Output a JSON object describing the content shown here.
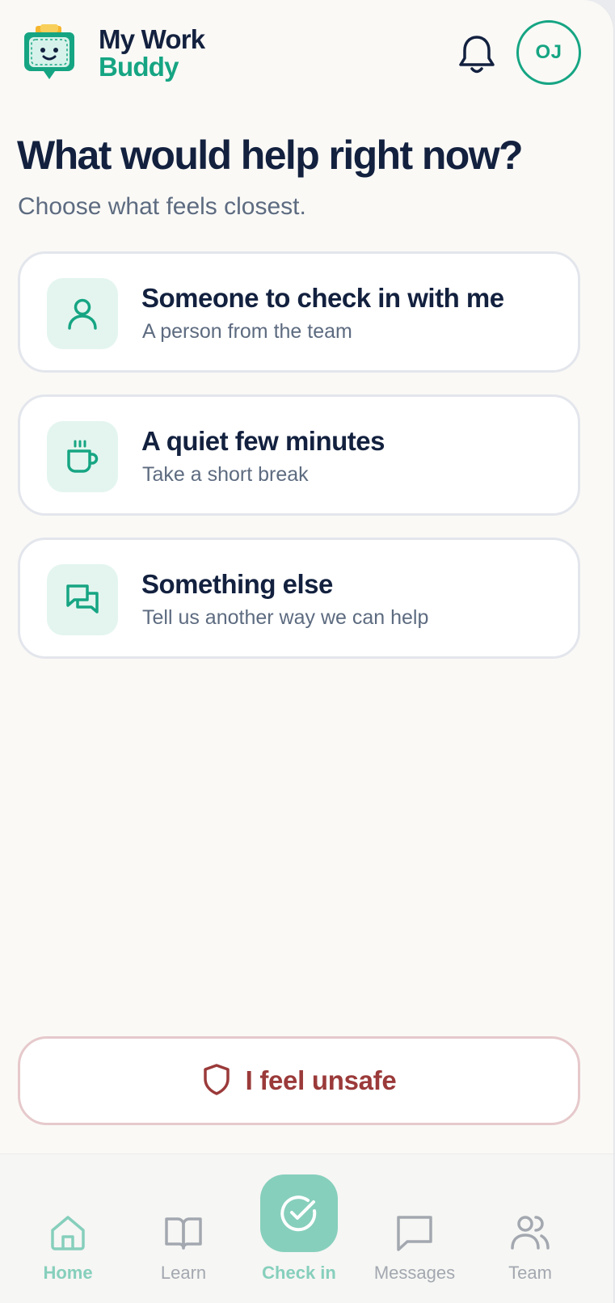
{
  "app": {
    "brand_line1": "My Work",
    "brand_line2": "Buddy",
    "avatar_initials": "OJ"
  },
  "prompt": {
    "title": "What would help right now?",
    "subtitle": "Choose what feels closest."
  },
  "options": [
    {
      "icon": "person-icon",
      "title": "Someone to check in with me",
      "subtitle": "A person from the team"
    },
    {
      "icon": "coffee-cup-icon",
      "title": "A quiet few minutes",
      "subtitle": "Take a short break"
    },
    {
      "icon": "chat-bubbles-icon",
      "title": "Something else",
      "subtitle": "Tell us another way we can help"
    }
  ],
  "unsafe_button": {
    "label": "I feel unsafe",
    "icon": "shield-icon"
  },
  "nav": [
    {
      "label": "Home",
      "icon": "home-icon",
      "active": true
    },
    {
      "label": "Learn",
      "icon": "book-icon",
      "active": false
    },
    {
      "label": "Check in",
      "icon": "check-circle-icon",
      "active": true
    },
    {
      "label": "Messages",
      "icon": "message-icon",
      "active": false
    },
    {
      "label": "Team",
      "icon": "team-icon",
      "active": false
    }
  ],
  "colors": {
    "brand_navy": "#13213f",
    "brand_green": "#16a583",
    "accent_soft": "#86cfbc",
    "danger": "#9b3a3a",
    "muted_text": "#5d6b80"
  }
}
